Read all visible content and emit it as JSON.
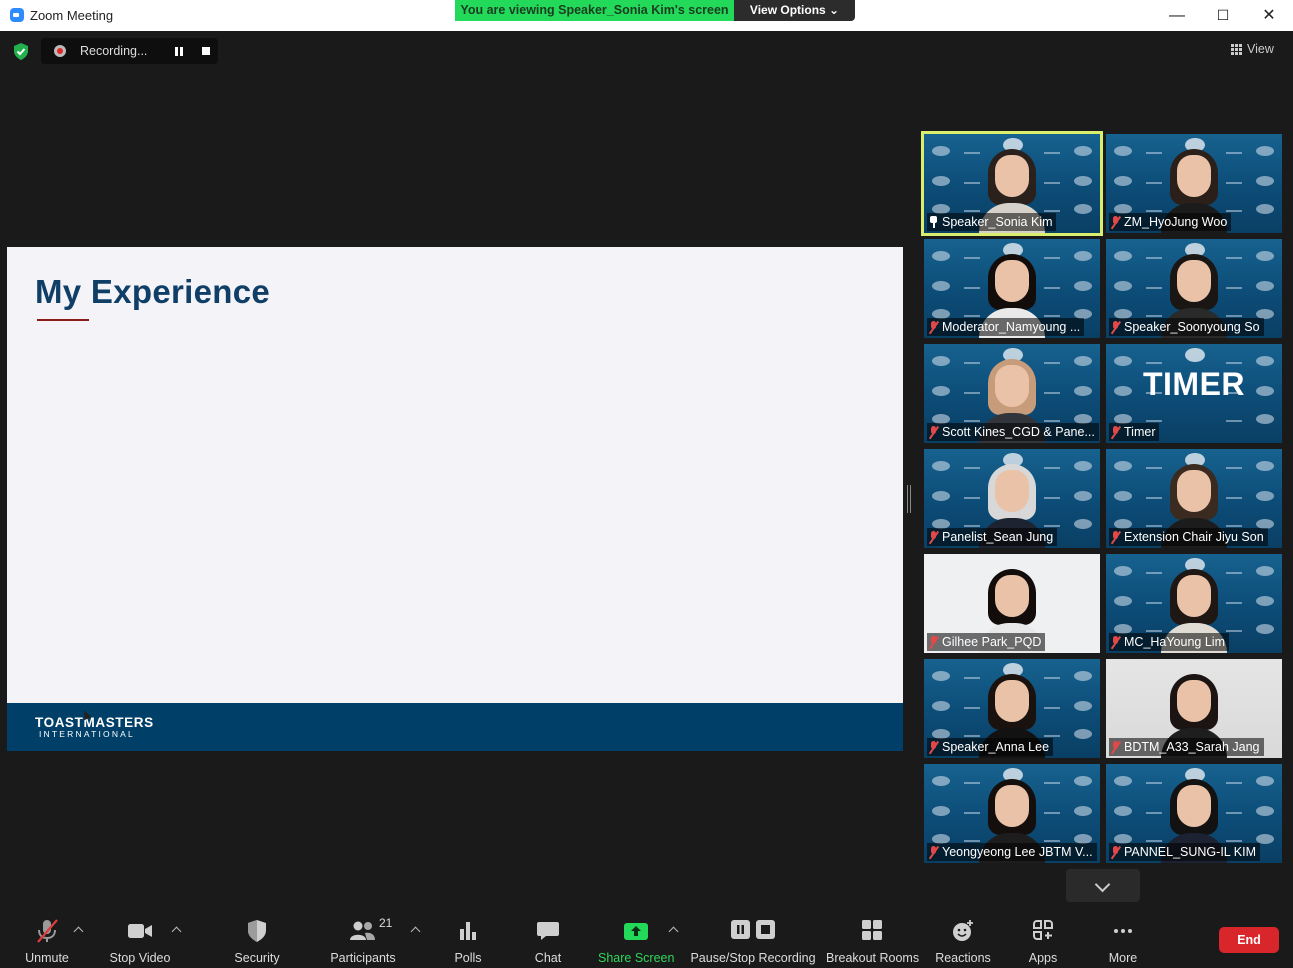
{
  "window": {
    "title": "Zoom Meeting",
    "minimize": "—",
    "maximize": "☐",
    "close": "✕"
  },
  "banner": {
    "viewing": "You are viewing Speaker_Sonia Kim's screen",
    "view_options": "View Options ⌄"
  },
  "recording": {
    "label": "Recording..."
  },
  "view_button": {
    "label": "View"
  },
  "slide": {
    "title": "My Experience",
    "brand_top": "TOASTMASTERS",
    "brand_bottom": "INTERNATIONAL"
  },
  "gallery": {
    "participants": [
      {
        "name": "Speaker_Sonia Kim",
        "muted": false,
        "active": true
      },
      {
        "name": "ZM_HyoJung Woo",
        "muted": true
      },
      {
        "name": "Moderator_Namyoung ...",
        "muted": true
      },
      {
        "name": "Speaker_Soonyoung So",
        "muted": true
      },
      {
        "name": "Scott Kines_CGD & Pane...",
        "muted": true
      },
      {
        "name": "Timer",
        "muted": true,
        "banner_text": "TIMER"
      },
      {
        "name": "Panelist_Sean Jung",
        "muted": true
      },
      {
        "name": "Extension Chair Jiyu Son",
        "muted": true
      },
      {
        "name": "Gilhee Park_PQD",
        "muted": true
      },
      {
        "name": "MC_HaYoung Lim",
        "muted": true
      },
      {
        "name": "Speaker_Anna Lee",
        "muted": true
      },
      {
        "name": "BDTM_A33_Sarah Jang",
        "muted": true
      },
      {
        "name": "Yeongyeong Lee JBTM V...",
        "muted": true
      },
      {
        "name": "PANNEL_SUNG-IL KIM",
        "muted": true
      }
    ]
  },
  "toolbar": {
    "unmute": "Unmute",
    "stop_video": "Stop Video",
    "security": "Security",
    "participants": "Participants",
    "participants_count": "21",
    "polls": "Polls",
    "chat": "Chat",
    "share_screen": "Share Screen",
    "pause_stop_recording": "Pause/Stop Recording",
    "breakout_rooms": "Breakout Rooms",
    "reactions": "Reactions",
    "apps": "Apps",
    "more": "More",
    "end": "End"
  },
  "colors": {
    "share_green": "#23d959",
    "end_red": "#d8262a",
    "active_outline": "#d9ee6c",
    "slide_title": "#0f3e67",
    "slide_footer": "#003f68"
  }
}
